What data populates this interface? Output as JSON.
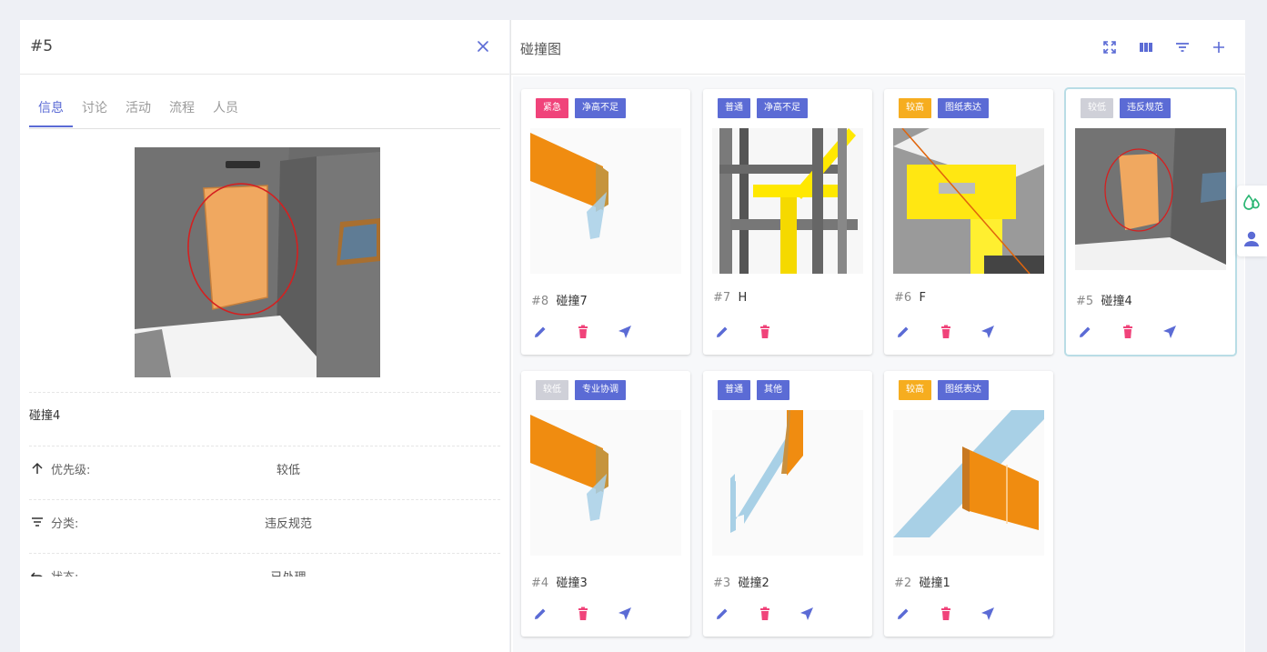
{
  "detail": {
    "title": "#5",
    "tabs": [
      "信息",
      "讨论",
      "活动",
      "流程",
      "人员"
    ],
    "active_tab": 0,
    "name": "碰撞4",
    "fields": [
      {
        "icon": "arrow-up-icon",
        "label": "优先级:",
        "value": "较低"
      },
      {
        "icon": "filter-icon",
        "label": "分类:",
        "value": "违反规范"
      },
      {
        "icon": "undo-icon",
        "label": "状态:",
        "value": "已处理"
      }
    ]
  },
  "board": {
    "title": "碰撞图",
    "tools": [
      "fullscreen-icon",
      "columns-icon",
      "filter-icon",
      "add-icon"
    ]
  },
  "tag_colors": {
    "紧急": "#f0437a",
    "普通": "#5b6bd5",
    "较高": "#f6ad1f",
    "较低": "#cfd0d8",
    "category": "#5b6bd5"
  },
  "cards": [
    {
      "number": "#8",
      "name": "碰撞7",
      "priority": "紧急",
      "category": "净高不足",
      "scene": "orange-panel",
      "locate": true
    },
    {
      "number": "#7",
      "name": "H",
      "priority": "普通",
      "category": "净高不足",
      "scene": "steel-frame",
      "locate": false
    },
    {
      "number": "#6",
      "name": "F",
      "priority": "较高",
      "category": "图纸表达",
      "scene": "yellow-beam",
      "locate": true
    },
    {
      "number": "#5",
      "name": "碰撞4",
      "priority": "较低",
      "category": "违反规范",
      "scene": "door",
      "locate": true,
      "selected": true
    },
    {
      "number": "#4",
      "name": "碰撞3",
      "priority": "较低",
      "category": "专业协调",
      "scene": "orange-panel",
      "locate": true
    },
    {
      "number": "#3",
      "name": "碰撞2",
      "priority": "普通",
      "category": "其他",
      "scene": "blue-wall",
      "locate": true
    },
    {
      "number": "#2",
      "name": "碰撞1",
      "priority": "较高",
      "category": "图纸表达",
      "scene": "orange-cross",
      "locate": true
    }
  ],
  "side_buttons": [
    "drops-icon",
    "user-icon"
  ]
}
